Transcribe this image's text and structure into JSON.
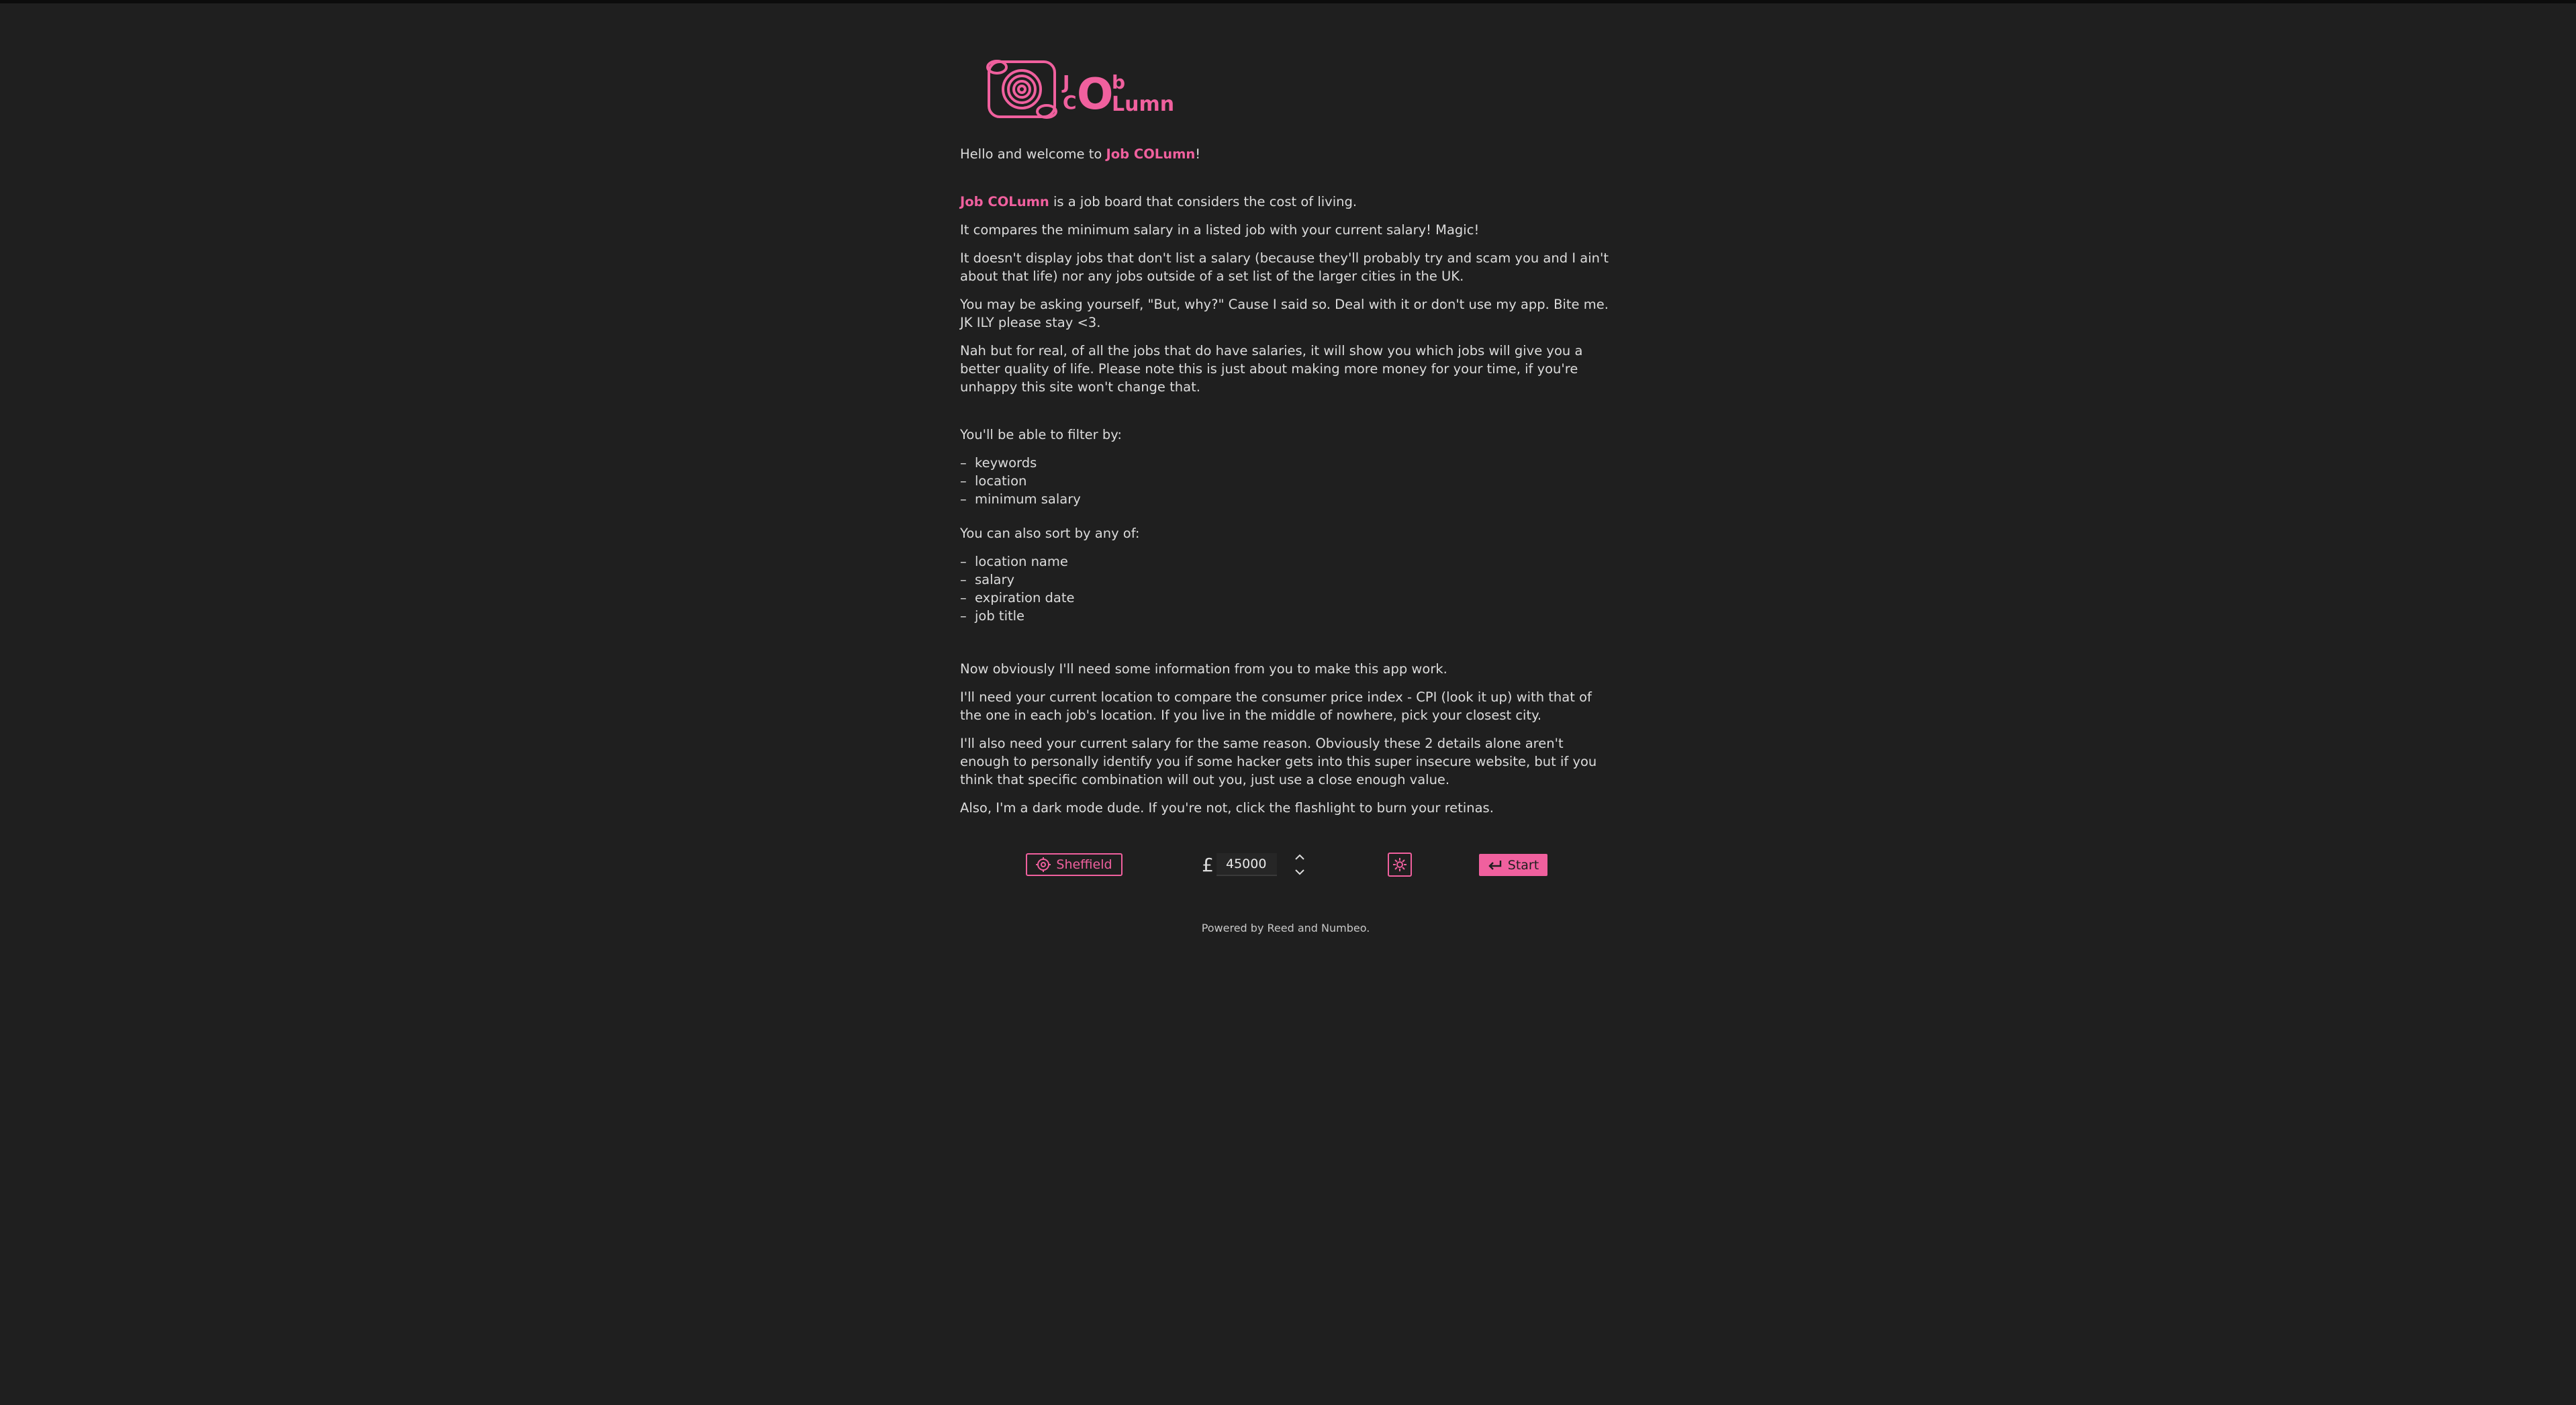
{
  "logo": {
    "name": "Job COLumn logo",
    "letters": [
      "J",
      "C",
      "O",
      "b",
      "L",
      "umn"
    ]
  },
  "brand": "Job COLumn",
  "colors": {
    "accent": "#f0609e",
    "background": "#1f1f1f",
    "text": "#dcdcdc"
  },
  "intro": {
    "greeting_pre": "Hello and welcome to ",
    "greeting_brand": "Job COLumn",
    "greeting_post": "!",
    "p1_brand": "Job COLumn",
    "p1_rest": " is a job board that considers the cost of living.",
    "p2": "It compares the minimum salary in a listed job with your current salary! Magic!",
    "p3": "It doesn't display jobs that don't list a salary (because they'll probably try and scam you and I ain't about that life) nor any jobs outside of a set list of the larger cities in the UK.",
    "p4": "You may be asking yourself, \"But, why?\" Cause I said so. Deal with it or don't use my app. Bite me. JK ILY please stay <3.",
    "p5": "Nah but for real, of all the jobs that do have salaries, it will show you which jobs will give you a better quality of life. Please note this is just about making more money for your time, if you're unhappy this site won't change that."
  },
  "filters": {
    "heading": "You'll be able to filter by:",
    "items": [
      "keywords",
      "location",
      "minimum salary"
    ]
  },
  "sorts": {
    "heading": "You can also sort by any of:",
    "items": [
      "location name",
      "salary",
      "expiration date",
      "job title"
    ]
  },
  "info": {
    "p1": "Now obviously I'll need some information from you to make this app work.",
    "p2": "I'll need your current location to compare the consumer price index - CPI (look it up) with that of the one in each job's location. If you live in the middle of nowhere, pick your closest city.",
    "p3": "I'll also need your current salary for the same reason. Obviously these 2 details alone aren't enough to personally identify you if some hacker gets into this super insecure website, but if you think that specific combination will out you, just use a close enough value.",
    "p4": "Also, I'm a dark mode dude. If you're not, click the flashlight to burn your retinas."
  },
  "controls": {
    "location_label": "Sheffield",
    "location_icon": "crosshair-icon",
    "currency_symbol": "£",
    "salary_value": "45000",
    "flashlight_icon": "flashlight-icon",
    "start_label": "Start",
    "start_icon": "enter-arrow-icon"
  },
  "footer": {
    "text": "Powered by Reed and Numbeo."
  }
}
